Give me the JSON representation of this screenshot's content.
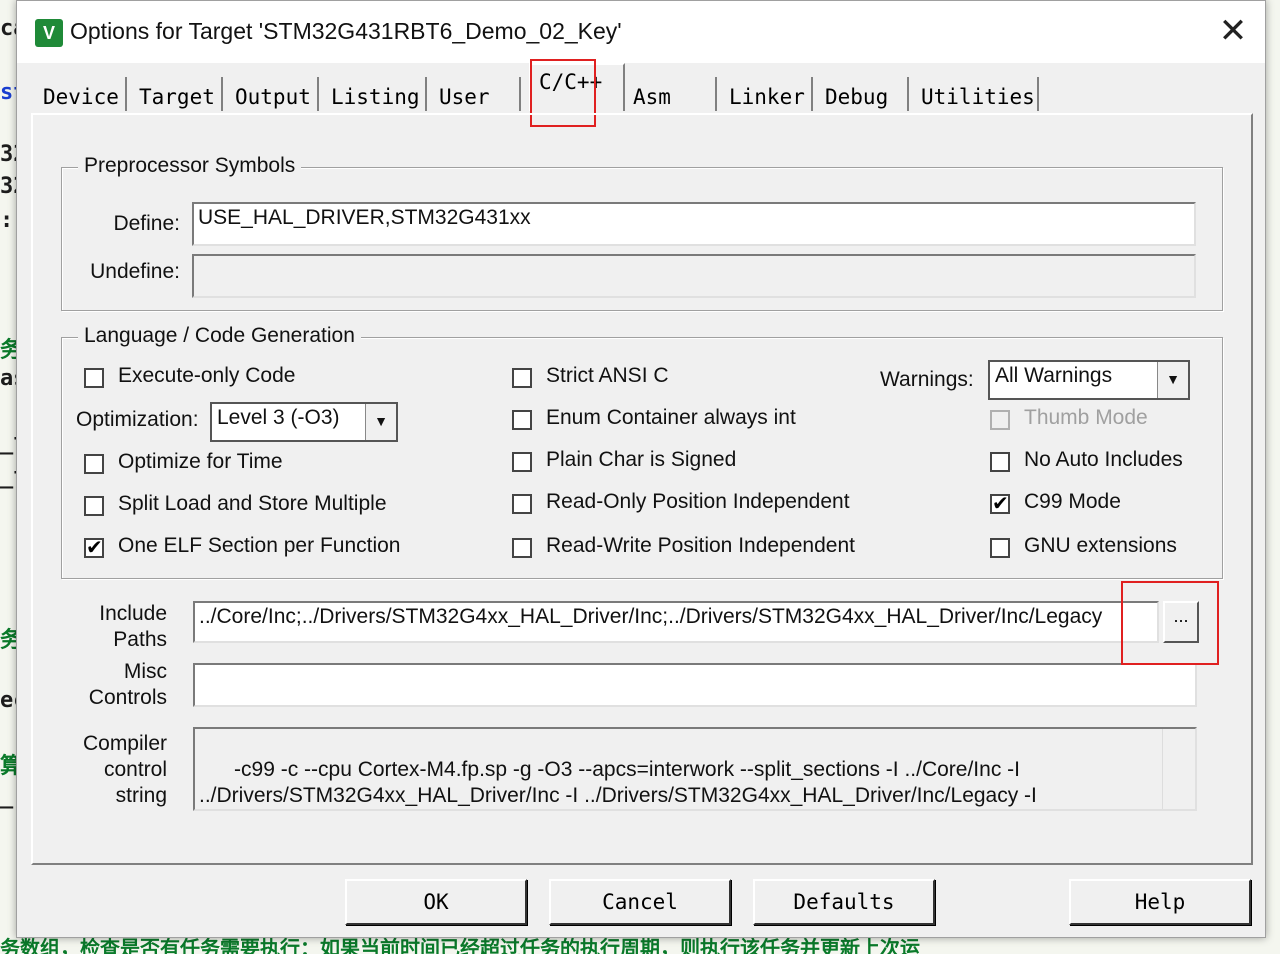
{
  "background": {
    "left_fragments": [
      "ca",
      "st",
      "32",
      "32",
      ":",
      "务",
      "as",
      "_t",
      "_t",
      "务",
      "ec",
      "算",
      "_r",
      ""
    ],
    "bottom_text": "务数组，检查是否有任务需要执行：如果当前时间已经超过任务的执行周期，则执行该任务并更新上次运"
  },
  "window": {
    "icon": "keil-uvision-icon",
    "title": "Options for Target 'STM32G431RBT6_Demo_02_Key'",
    "close": "✕"
  },
  "tabs": [
    "Device",
    "Target",
    "Output",
    "Listing",
    "User",
    "C/C++",
    "Asm",
    "Linker",
    "Debug",
    "Utilities"
  ],
  "active_tab": "C/C++",
  "preprocessor": {
    "title": "Preprocessor Symbols",
    "define_label": "Define:",
    "define_value": "USE_HAL_DRIVER,STM32G431xx",
    "undefine_label": "Undefine:",
    "undefine_value": ""
  },
  "language": {
    "title": "Language / Code Generation",
    "execute_only": {
      "label": "Execute-only Code",
      "checked": false
    },
    "optimization_label": "Optimization:",
    "optimization_value": "Level 3 (-O3)",
    "optimize_time": {
      "label": "Optimize for Time",
      "checked": false
    },
    "split_load": {
      "label": "Split Load and Store Multiple",
      "checked": false
    },
    "one_elf": {
      "label": "One ELF Section per Function",
      "checked": true
    },
    "strict_ansi": {
      "label": "Strict ANSI C",
      "checked": false
    },
    "enum_container": {
      "label": "Enum Container always int",
      "checked": false
    },
    "plain_char": {
      "label": "Plain Char is Signed",
      "checked": false
    },
    "ropi": {
      "label": "Read-Only Position Independent",
      "checked": false
    },
    "rwpi": {
      "label": "Read-Write Position Independent",
      "checked": false
    },
    "warnings_label": "Warnings:",
    "warnings_value": "All Warnings",
    "thumb_mode": {
      "label": "Thumb Mode",
      "checked": false
    },
    "no_auto_includes": {
      "label": "No Auto Includes",
      "checked": false
    },
    "c99_mode": {
      "label": "C99 Mode",
      "checked": true
    },
    "gnu_extensions": {
      "label": "GNU extensions",
      "checked": false
    }
  },
  "paths": {
    "include_label_1": "Include",
    "include_label_2": "Paths",
    "include_value": "../Core/Inc;../Drivers/STM32G4xx_HAL_Driver/Inc;../Drivers/STM32G4xx_HAL_Driver/Inc/Legacy",
    "browse_label": "...",
    "misc_label_1": "Misc",
    "misc_label_2": "Controls",
    "misc_value": "",
    "compiler_label_1": "Compiler",
    "compiler_label_2": "control",
    "compiler_label_3": "string",
    "compiler_value": "-c99 -c --cpu Cortex-M4.fp.sp -g -O3 --apcs=interwork --split_sections -I ../Core/Inc -I\n../Drivers/STM32G4xx_HAL_Driver/Inc -I ../Drivers/STM32G4xx_HAL_Driver/Inc/Legacy -I"
  },
  "buttons": {
    "ok": "OK",
    "cancel": "Cancel",
    "defaults": "Defaults",
    "help": "Help"
  },
  "colors": {
    "highlight": "#e02020",
    "dialog_bg": "#f0f0f0"
  }
}
